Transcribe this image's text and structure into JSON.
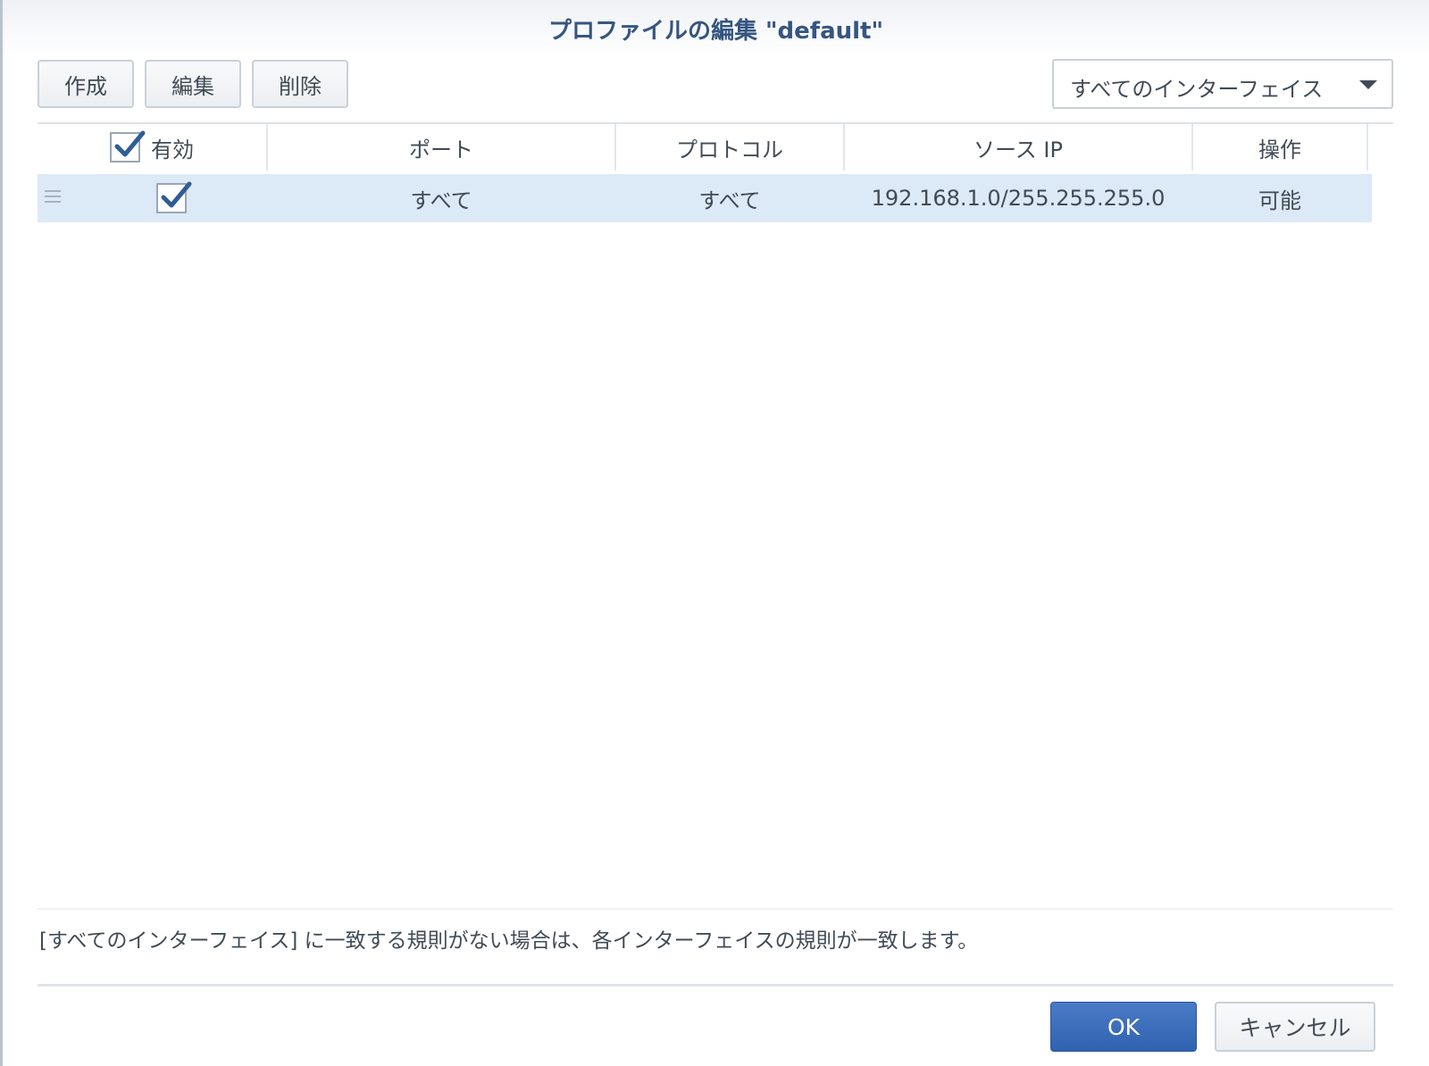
{
  "dialog": {
    "title": "プロファイルの編集 \"default\""
  },
  "toolbar": {
    "create_label": "作成",
    "edit_label": "編集",
    "delete_label": "削除",
    "interface_filter": "すべてのインターフェイス"
  },
  "grid": {
    "columns": {
      "enabled": "有効",
      "port": "ポート",
      "protocol": "プロトコル",
      "source_ip": "ソース IP",
      "action": "操作"
    },
    "header_enabled_checked": true,
    "rows": [
      {
        "enabled": true,
        "port": "すべて",
        "protocol": "すべて",
        "source_ip": "192.168.1.0/255.255.255.0",
        "action": "可能"
      }
    ]
  },
  "info_text": "[すべてのインターフェイス] に一致する規則がない場合は、各インターフェイスの規則が一致します。",
  "footer": {
    "ok_label": "OK",
    "cancel_label": "キャンセル"
  },
  "colors": {
    "title": "#355580",
    "selected_row": "#dce9f7",
    "primary_button": "#2f62b0",
    "check": "#2f5d94"
  }
}
